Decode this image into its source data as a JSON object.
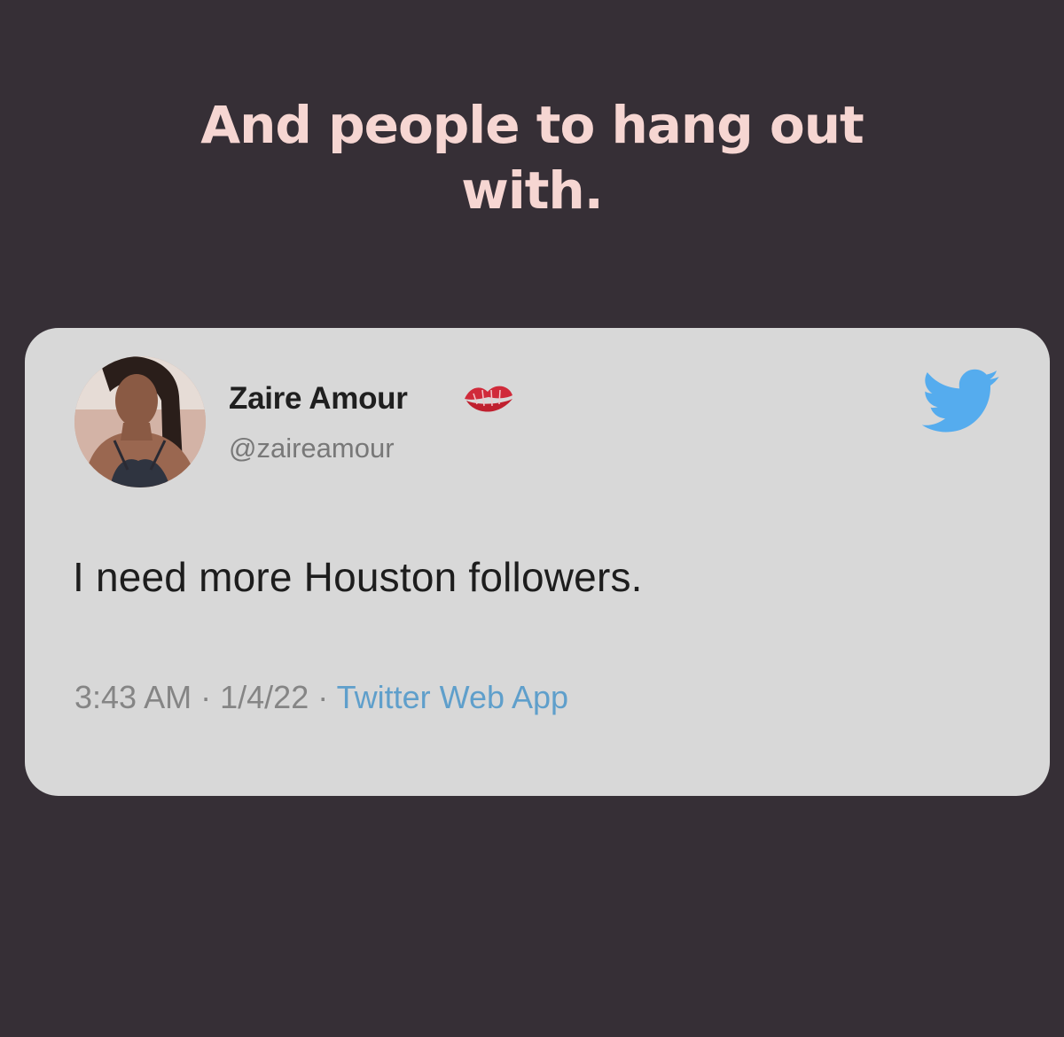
{
  "headline": {
    "line1": "And people to hang out",
    "line2": "with."
  },
  "tweet": {
    "display_name": "Zaire Amour",
    "name_emoji": "kiss-mark-icon",
    "handle": "@zaireamour",
    "text": "I need more Houston followers.",
    "time": "3:43 AM",
    "date": "1/4/22",
    "separator": "·",
    "source": "Twitter Web App",
    "brand_icon": "twitter-bird-icon"
  },
  "colors": {
    "background": "#362f36",
    "headline": "#f6d6d2",
    "card": "#d8d8d8",
    "twitter_blue": "#55acee",
    "source_link": "#5f9fcb",
    "kiss_red": "#d02a3a"
  }
}
